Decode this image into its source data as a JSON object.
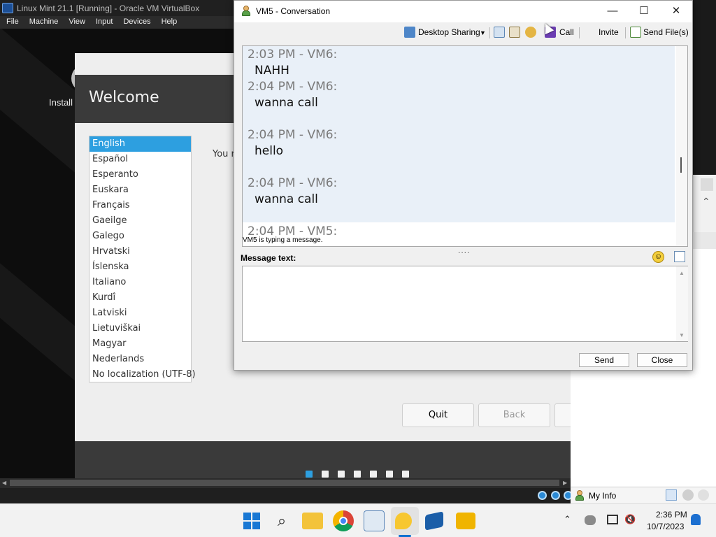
{
  "vbox": {
    "window_title": "Linux Mint 21.1 [Running] - Oracle VM VirtualBox",
    "menu": [
      "File",
      "Machine",
      "View",
      "Input",
      "Devices",
      "Help"
    ]
  },
  "guest": {
    "install_label": "Install",
    "installer": {
      "title": "Welcome",
      "body_text_partial": "You r",
      "languages": [
        "English",
        "Español",
        "Esperanto",
        "Euskara",
        "Français",
        "Gaeilge",
        "Galego",
        "Hrvatski",
        "Íslenska",
        "Italiano",
        "Kurdî",
        "Latviski",
        "Lietuviškai",
        "Magyar",
        "Nederlands",
        "No localization (UTF-8)"
      ],
      "selected_language": "English",
      "buttons": {
        "quit": "Quit",
        "back": "Back"
      },
      "step_dots_total": 7,
      "active_step": 1
    }
  },
  "conversation": {
    "title": "VM5 - Conversation",
    "toolbar": {
      "desktop_sharing": "Desktop Sharing",
      "call": "Call",
      "invite": "Invite",
      "send_files": "Send File(s)"
    },
    "messages": [
      {
        "header": "2:03 PM - VM6:",
        "text": "NAHH"
      },
      {
        "header": "2:04 PM - VM6:",
        "text": "wanna call"
      },
      {
        "header": "2:04 PM - VM6:",
        "text": "hello"
      },
      {
        "header": "2:04 PM - VM6:",
        "text": "wanna call"
      },
      {
        "header": "2:04 PM - VM5:",
        "text": ""
      }
    ],
    "typing_status": "VM5 is typing a message.",
    "splitter": "....",
    "message_label": "Message text:",
    "message_value": "",
    "send_label": "Send",
    "close_label": "Close"
  },
  "right_panel": {
    "my_info": "My Info"
  },
  "taskbar": {
    "time": "2:36 PM",
    "date": "10/7/2023"
  },
  "colors": {
    "selection_blue": "#2d9fe0",
    "chat_background": "#e9f0f8",
    "taskbar_accent": "#0a6fd0"
  }
}
